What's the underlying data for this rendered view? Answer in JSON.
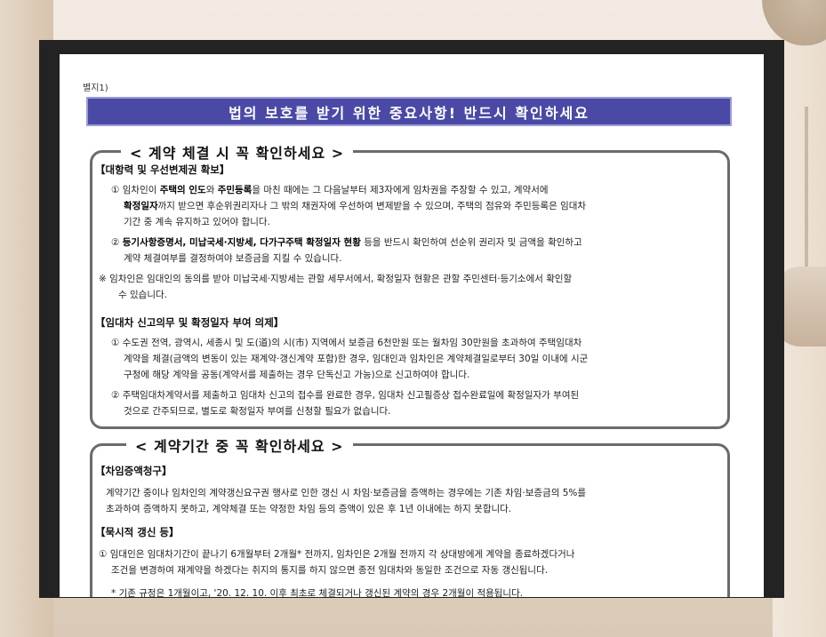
{
  "document": {
    "annex_label": "별지1)",
    "banner_title": "법의 보호를 받기 위한 중요사항! 반드시 확인하세요",
    "section1": {
      "title": "< 계약 체결 시 꼭 확인하세요 >",
      "heading1": "【대항력 및 우선변제권 확보】",
      "item1_line1_a": "① 임차인이 ",
      "item1_line1_b": "주택의 인도",
      "item1_line1_c": "와 ",
      "item1_line1_d": "주민등록",
      "item1_line1_e": "을 마친 때에는 그 다음날부터 제3자에게 임차권을 주장할 수 있고, 계약서에",
      "item1_line2_a": "확정일자",
      "item1_line2_b": "까지 받으면 후순위권리자나 그 밖의 채권자에 우선하여 변제받을 수 있으며, 주택의 점유와 주민등록은 임대차",
      "item1_line3": "기간 중 계속 유지하고 있어야 합니다.",
      "item2_line1_a": "② ",
      "item2_line1_b": "등기사항증명서, 미납국세·지방세, 다가구주택 확정일자 현황",
      "item2_line1_c": " 등을 반드시 확인하여 선순위 권리자 및 금액을 확인하고",
      "item2_line2": "계약 체결여부를 결정하여야 보증금을 지킬 수 있습니다.",
      "note_line1": "※ 임차인은 임대인의 동의를 받아 미납국세·지방세는 관할 세무서에서, 확정일자 현황은 관할 주민센터·등기소에서 확인할",
      "note_line2": "수 있습니다.",
      "heading2": "【임대차 신고의무 및 확정일자 부여 의제】",
      "item3_line1": "① 수도권 전역, 광역시, 세종시 및 도(道)의 시(市) 지역에서 보증금 6천만원 또는 월차임 30만원을 초과하여 주택임대차",
      "item3_line2": "계약을 체결(금액의 변동이 있는 재계약·갱신계약 포함)한 경우, 임대인과 임차인은 계약체결일로부터 30일 이내에 시군",
      "item3_line3": "구청에 해당 계약을 공동(계약서를 제출하는 경우 단독신고 가능)으로 신고하여야 합니다.",
      "item4_line1": "② 주택임대차계약서를 제출하고 임대차 신고의 접수를 완료한 경우, 임대차 신고필증상 접수완료일에 확정일자가 부여된",
      "item4_line2": "것으로 간주되므로, 별도로 확정일자 부여를 신청할 필요가 없습니다."
    },
    "section2": {
      "title": "< 계약기간 중 꼭 확인하세요 >",
      "heading1": "【차임증액청구】",
      "para1_line1": "계약기간 중이나 임차인의 계약갱신요구권 행사로 인한 갱신 시 차임·보증금을 증액하는 경우에는 기존 차임·보증금의 5%를",
      "para1_line2": "초과하여 증액하지 못하고, 계약체결 또는 약정한 차임 등의 증액이 있은 후 1년 이내에는 하지 못합니다.",
      "heading2": "【묵시적 갱신 등】",
      "item1_line1": "① 임대인은 임대차기간이 끝나기 6개월부터 2개월* 전까지, 임차인은 2개월 전까지 각 상대방에게 계약을 종료하겠다거나",
      "item1_line2": "조건을 변경하여 재계약을 하겠다는 취지의 통지를 하지 않으면 종전 임대차와 동일한 조건으로 자동 갱신됩니다.",
      "footnote": "* 기존 규정은 1개월이고, '20. 12. 10. 이후 최초로 체결되거나 갱신된 계약의 경우 2개월이 적용됩니다."
    }
  }
}
